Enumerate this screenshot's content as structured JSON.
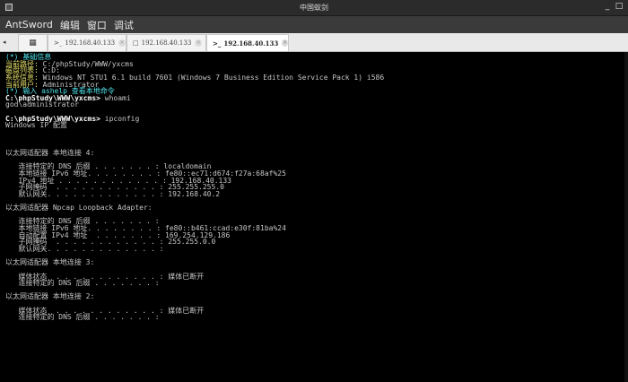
{
  "window": {
    "title": "中国蚁剑",
    "min_label": "_",
    "max_label": "□"
  },
  "menubar": {
    "items": [
      "AntSword",
      "编辑",
      "窗口",
      "调试"
    ]
  },
  "tabbar": {
    "nav_label": "◂",
    "tabs": [
      {
        "label": "192.168.40.133",
        "icon": ">_",
        "close": "×"
      },
      {
        "label": "192.168.40.133",
        "icon": "□",
        "close": "×"
      },
      {
        "label": "192.168.40.133",
        "icon": ">_",
        "close": "×"
      }
    ]
  },
  "terminal": {
    "info_header": "(*) 基础信息",
    "info": [
      {
        "label": "当前路径:",
        "value": " C:/phpStudy/WWW/yxcms"
      },
      {
        "label": "磁盘列表:",
        "value": " C:D:"
      },
      {
        "label": "系统信息:",
        "value": " Windows NT STU1 6.1 build 7601 (Windows 7 Business Edition Service Pack 1) i586"
      },
      {
        "label": "当前用户:",
        "value": " Administrator"
      }
    ],
    "help_hint": "(*) 输入 ashelp 查看本地命令",
    "cmd1_prompt": "C:\\phpStudy\\WWW\\yxcms>",
    "cmd1": " whoami",
    "cmd1_out": "god\\administrator",
    "cmd2_prompt": "C:\\phpStudy\\WWW\\yxcms>",
    "cmd2": " ipconfig",
    "lines": [
      "Windows IP 配置",
      "",
      "",
      "",
      "以太网适配器 本地连接 4:",
      "",
      "   连接特定的 DNS 后缀 . . . . . . . : localdomain",
      "   本地链接 IPv6 地址. . . . . . . . : fe80::ec71:d674:f27a:68af%25",
      "   IPv4 地址 . . . . . . . . . . . . : 192.168.40.133",
      "   子网掩码  . . . . . . . . . . . . : 255.255.255.0",
      "   默认网关. . . . . . . . . . . . . : 192.168.40.2",
      "",
      "以太网适配器 Npcap Loopback Adapter:",
      "",
      "   连接特定的 DNS 后缀 . . . . . . . :",
      "   本地链接 IPv6 地址. . . . . . . . : fe80::b461:ccad:e30f:81ba%24",
      "   自动配置 IPv4 地址  . . . . . . . : 169.254.129.186",
      "   子网掩码  . . . . . . . . . . . . : 255.255.0.0",
      "   默认网关. . . . . . . . . . . . . :",
      "",
      "以太网适配器 本地连接 3:",
      "",
      "   媒体状态  . . . . . . . . . . . . : 媒体已断开",
      "   连接特定的 DNS 后缀 . . . . . . . :",
      "",
      "以太网适配器 本地连接 2:",
      "",
      "   媒体状态  . . . . . . . . . . . . : 媒体已断开",
      "   连接特定的 DNS 后缀 . . . . . . . :"
    ]
  }
}
